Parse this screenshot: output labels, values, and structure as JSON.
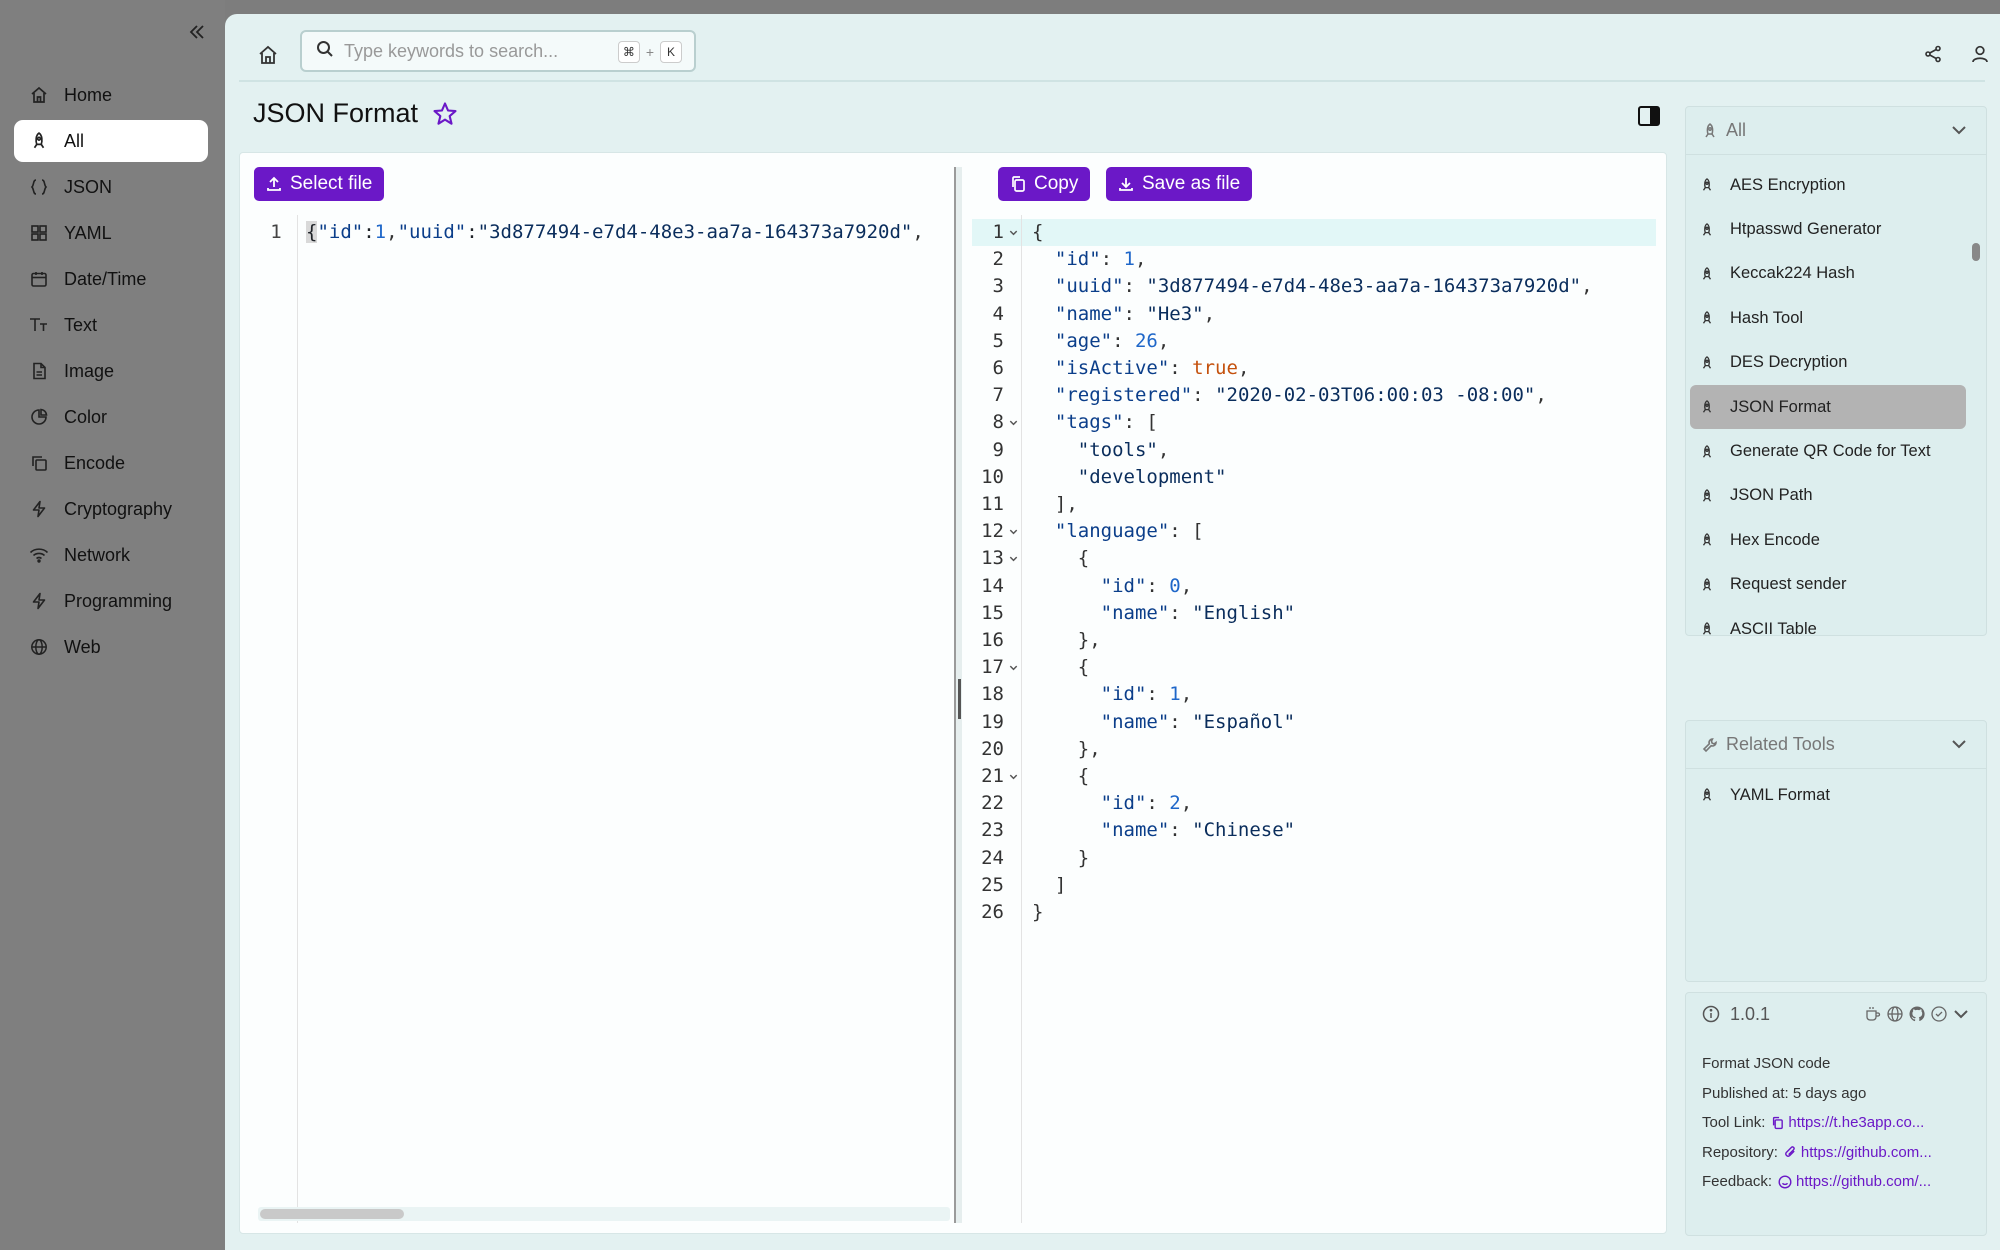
{
  "sidebar": {
    "items": [
      {
        "label": "Home",
        "icon": "home-icon"
      },
      {
        "label": "All",
        "icon": "rocket-icon",
        "active": true
      },
      {
        "label": "JSON",
        "icon": "braces-icon"
      },
      {
        "label": "YAML",
        "icon": "grid-icon"
      },
      {
        "label": "Date/Time",
        "icon": "calendar-icon"
      },
      {
        "label": "Text",
        "icon": "text-size-icon"
      },
      {
        "label": "Image",
        "icon": "image-file-icon"
      },
      {
        "label": "Color",
        "icon": "pie-icon"
      },
      {
        "label": "Encode",
        "icon": "copy-icon"
      },
      {
        "label": "Cryptography",
        "icon": "bolt-icon"
      },
      {
        "label": "Network",
        "icon": "wifi-icon"
      },
      {
        "label": "Programming",
        "icon": "bolt-icon"
      },
      {
        "label": "Web",
        "icon": "globe-icon"
      }
    ]
  },
  "topbar": {
    "search_placeholder": "Type keywords to search...",
    "shortcut_mod": "⌘",
    "shortcut_plus": "+",
    "shortcut_key": "K"
  },
  "page": {
    "title": "JSON Format",
    "select_file_label": "Select file",
    "copy_label": "Copy",
    "save_label": "Save as file"
  },
  "input_editor": {
    "line_number": "1",
    "content": "{\"id\":1,\"uuid\":\"3d877494-e7d4-48e3-aa7a-164373a7920d\","
  },
  "output_editor": {
    "lines": [
      [
        [
          "pun",
          "{"
        ]
      ],
      [
        [
          "pun",
          "  "
        ],
        [
          "key",
          "\"id\""
        ],
        [
          "pun",
          ": "
        ],
        [
          "num",
          "1"
        ],
        [
          "pun",
          ","
        ]
      ],
      [
        [
          "pun",
          "  "
        ],
        [
          "key",
          "\"uuid\""
        ],
        [
          "pun",
          ": "
        ],
        [
          "str",
          "\"3d877494-e7d4-48e3-aa7a-164373a7920d\""
        ],
        [
          "pun",
          ","
        ]
      ],
      [
        [
          "pun",
          "  "
        ],
        [
          "key",
          "\"name\""
        ],
        [
          "pun",
          ": "
        ],
        [
          "str",
          "\"He3\""
        ],
        [
          "pun",
          ","
        ]
      ],
      [
        [
          "pun",
          "  "
        ],
        [
          "key",
          "\"age\""
        ],
        [
          "pun",
          ": "
        ],
        [
          "num",
          "26"
        ],
        [
          "pun",
          ","
        ]
      ],
      [
        [
          "pun",
          "  "
        ],
        [
          "key",
          "\"isActive\""
        ],
        [
          "pun",
          ": "
        ],
        [
          "bool",
          "true"
        ],
        [
          "pun",
          ","
        ]
      ],
      [
        [
          "pun",
          "  "
        ],
        [
          "key",
          "\"registered\""
        ],
        [
          "pun",
          ": "
        ],
        [
          "str",
          "\"2020-02-03T06:00:03 -08:00\""
        ],
        [
          "pun",
          ","
        ]
      ],
      [
        [
          "pun",
          "  "
        ],
        [
          "key",
          "\"tags\""
        ],
        [
          "pun",
          ": ["
        ]
      ],
      [
        [
          "pun",
          "    "
        ],
        [
          "str",
          "\"tools\""
        ],
        [
          "pun",
          ","
        ]
      ],
      [
        [
          "pun",
          "    "
        ],
        [
          "str",
          "\"development\""
        ]
      ],
      [
        [
          "pun",
          "  ],"
        ]
      ],
      [
        [
          "pun",
          "  "
        ],
        [
          "key",
          "\"language\""
        ],
        [
          "pun",
          ": ["
        ]
      ],
      [
        [
          "pun",
          "    {"
        ]
      ],
      [
        [
          "pun",
          "      "
        ],
        [
          "key",
          "\"id\""
        ],
        [
          "pun",
          ": "
        ],
        [
          "num",
          "0"
        ],
        [
          "pun",
          ","
        ]
      ],
      [
        [
          "pun",
          "      "
        ],
        [
          "key",
          "\"name\""
        ],
        [
          "pun",
          ": "
        ],
        [
          "str",
          "\"English\""
        ]
      ],
      [
        [
          "pun",
          "    },"
        ]
      ],
      [
        [
          "pun",
          "    {"
        ]
      ],
      [
        [
          "pun",
          "      "
        ],
        [
          "key",
          "\"id\""
        ],
        [
          "pun",
          ": "
        ],
        [
          "num",
          "1"
        ],
        [
          "pun",
          ","
        ]
      ],
      [
        [
          "pun",
          "      "
        ],
        [
          "key",
          "\"name\""
        ],
        [
          "pun",
          ": "
        ],
        [
          "str",
          "\"Español\""
        ]
      ],
      [
        [
          "pun",
          "    },"
        ]
      ],
      [
        [
          "pun",
          "    {"
        ]
      ],
      [
        [
          "pun",
          "      "
        ],
        [
          "key",
          "\"id\""
        ],
        [
          "pun",
          ": "
        ],
        [
          "num",
          "2"
        ],
        [
          "pun",
          ","
        ]
      ],
      [
        [
          "pun",
          "      "
        ],
        [
          "key",
          "\"name\""
        ],
        [
          "pun",
          ": "
        ],
        [
          "str",
          "\"Chinese\""
        ]
      ],
      [
        [
          "pun",
          "    }"
        ]
      ],
      [
        [
          "pun",
          "  ]"
        ]
      ],
      [
        [
          "pun",
          "}"
        ]
      ]
    ],
    "foldable_lines": [
      1,
      8,
      12,
      13,
      17,
      21
    ]
  },
  "tools_panel": {
    "title": "All",
    "items": [
      {
        "label": "AES Encryption"
      },
      {
        "label": "Htpasswd Generator"
      },
      {
        "label": "Keccak224 Hash"
      },
      {
        "label": "Hash Tool"
      },
      {
        "label": "DES Decryption"
      },
      {
        "label": "JSON Format",
        "active": true
      },
      {
        "label": "Generate QR Code for Text"
      },
      {
        "label": "JSON Path"
      },
      {
        "label": "Hex Encode"
      },
      {
        "label": "Request sender"
      },
      {
        "label": "ASCII Table"
      }
    ]
  },
  "related_panel": {
    "title": "Related Tools",
    "items": [
      {
        "label": "YAML Format"
      }
    ]
  },
  "info_panel": {
    "version": "1.0.1",
    "description": "Format JSON code",
    "published": "Published at: 5 days ago",
    "tool_link_label": "Tool Link:",
    "tool_link": "https://t.he3app.co...",
    "repo_label": "Repository:",
    "repo_link": "https://github.com...",
    "feedback_label": "Feedback:",
    "feedback_link": "https://github.com/..."
  },
  "colors": {
    "accent": "#6b18c7",
    "sidebar_bg": "#7f7f7f",
    "main_bg": "#e3f1f1",
    "bool": "#c4510d",
    "number": "#1f67c9"
  }
}
